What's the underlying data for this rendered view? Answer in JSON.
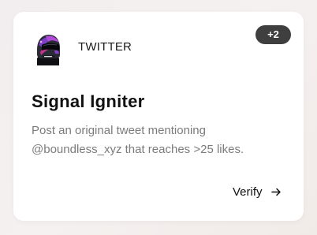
{
  "card": {
    "platform": "TWITTER",
    "badge": "+2",
    "title": "Signal Igniter",
    "description_line1": "Post an original tweet mentioning",
    "description_line2": "@boundless_xyz that reaches >25 likes.",
    "verify_label": "Verify",
    "icons": {
      "avatar": "helmet-avatar-icon",
      "verify": "arrow-right-icon"
    },
    "colors": {
      "badge_bg": "#3f3f3f",
      "title": "#111111",
      "description": "#7b7b7b"
    }
  }
}
